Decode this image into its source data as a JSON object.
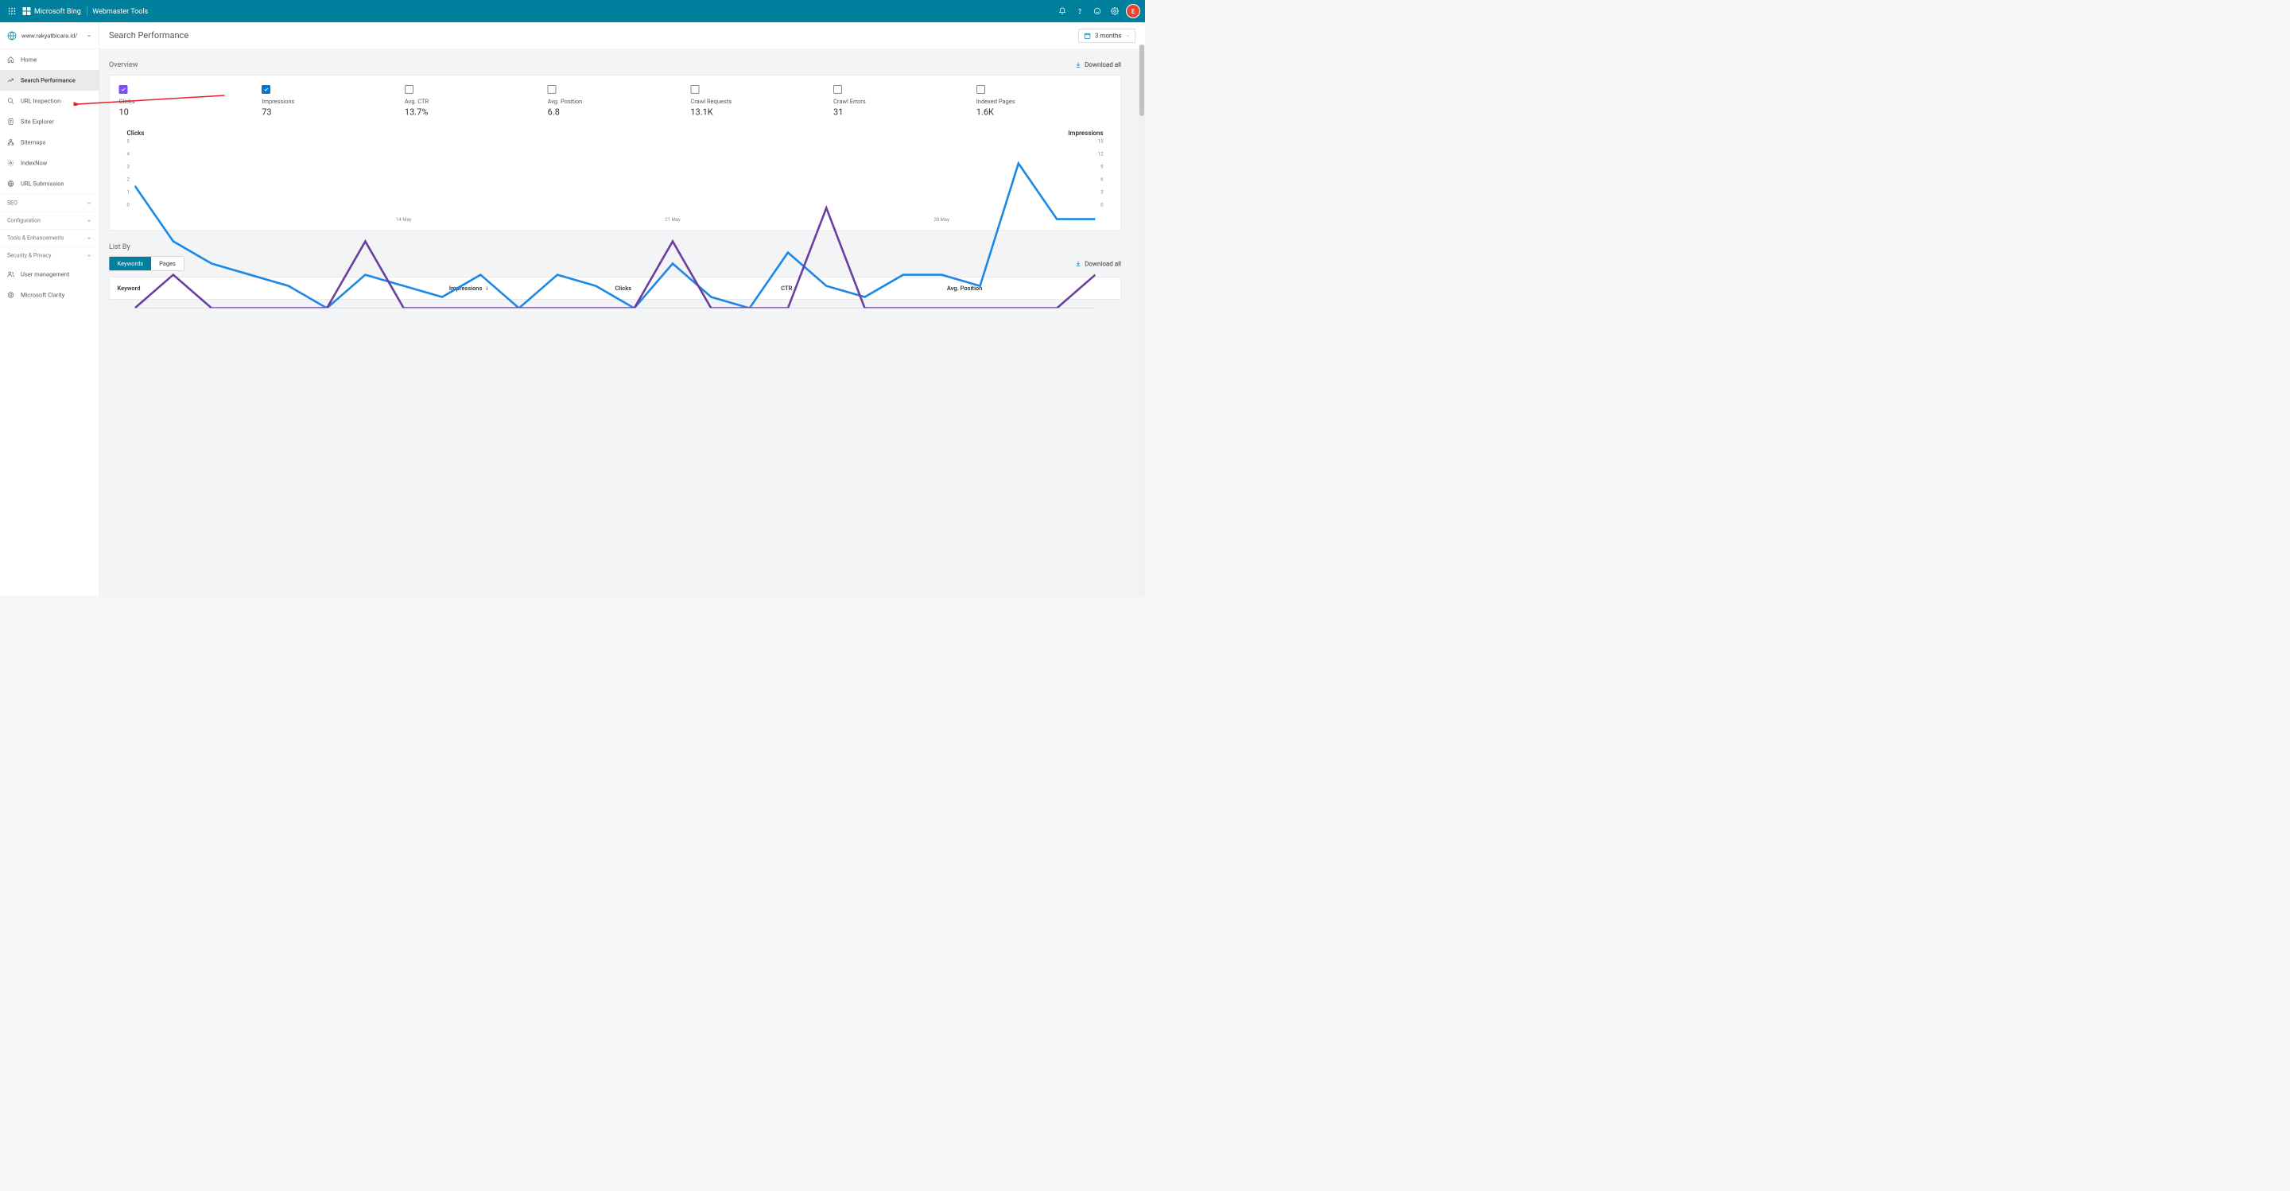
{
  "header": {
    "brand_main": "Microsoft Bing",
    "brand_sub": "Webmaster Tools",
    "avatar_letter": "E"
  },
  "sidebar": {
    "site_url": "www.rakyatbicara.id/",
    "nav": [
      {
        "label": "Home"
      },
      {
        "label": "Search Performance"
      },
      {
        "label": "URL Inspection"
      },
      {
        "label": "Site Explorer"
      },
      {
        "label": "Sitemaps"
      },
      {
        "label": "IndexNow"
      },
      {
        "label": "URL Submission"
      }
    ],
    "groups": [
      {
        "label": "SEO"
      },
      {
        "label": "Configuration"
      },
      {
        "label": "Tools & Enhancements"
      },
      {
        "label": "Security & Privacy"
      }
    ],
    "extra": [
      {
        "label": "User management"
      },
      {
        "label": "Microsoft Clarity"
      }
    ]
  },
  "page": {
    "title": "Search Performance",
    "date_range": "3 months",
    "overview_title": "Overview",
    "download_all": "Download all",
    "stats": [
      {
        "label": "Clicks",
        "value": "10",
        "checked": "purple"
      },
      {
        "label": "Impressions",
        "value": "73",
        "checked": "blue"
      },
      {
        "label": "Avg. CTR",
        "value": "13.7%",
        "checked": ""
      },
      {
        "label": "Avg. Position",
        "value": "6.8",
        "checked": ""
      },
      {
        "label": "Crawl Requests",
        "value": "13.1K",
        "checked": ""
      },
      {
        "label": "Crawl Errors",
        "value": "31",
        "checked": ""
      },
      {
        "label": "Indexed Pages",
        "value": "1.6K",
        "checked": ""
      }
    ],
    "chart_left_label": "Clicks",
    "chart_right_label": "Impressions",
    "list_by_title": "List By",
    "tabs": {
      "keywords": "Keywords",
      "pages": "Pages"
    },
    "columns": {
      "keyword": "Keyword",
      "impressions": "Impressions",
      "clicks": "Clicks",
      "ctr": "CTR",
      "avg_position": "Avg. Position"
    }
  },
  "chart_data": {
    "type": "line",
    "x_ticks": [
      "14 May",
      "21 May",
      "28 May"
    ],
    "left_axis": {
      "label": "Clicks",
      "ticks": [
        0,
        1,
        2,
        3,
        4,
        5
      ],
      "range": [
        0,
        5
      ]
    },
    "right_axis": {
      "label": "Impressions",
      "ticks": [
        0,
        3,
        6,
        9,
        12,
        15
      ],
      "range": [
        0,
        15
      ]
    },
    "series": [
      {
        "name": "Clicks",
        "axis": "left",
        "color": "#6B3FA0",
        "values": [
          0,
          1,
          0,
          0,
          0,
          0,
          2,
          0,
          0,
          0,
          0,
          0,
          0,
          0,
          2,
          0,
          0,
          0,
          3,
          0,
          0,
          0,
          0,
          0,
          0,
          1
        ]
      },
      {
        "name": "Impressions",
        "axis": "right",
        "color": "#1E88E5",
        "values": [
          11,
          6,
          4,
          3,
          2,
          0,
          3,
          2,
          1,
          3,
          0,
          3,
          2,
          0,
          4,
          1,
          0,
          5,
          2,
          1,
          3,
          3,
          2,
          13,
          8,
          8
        ]
      }
    ]
  }
}
